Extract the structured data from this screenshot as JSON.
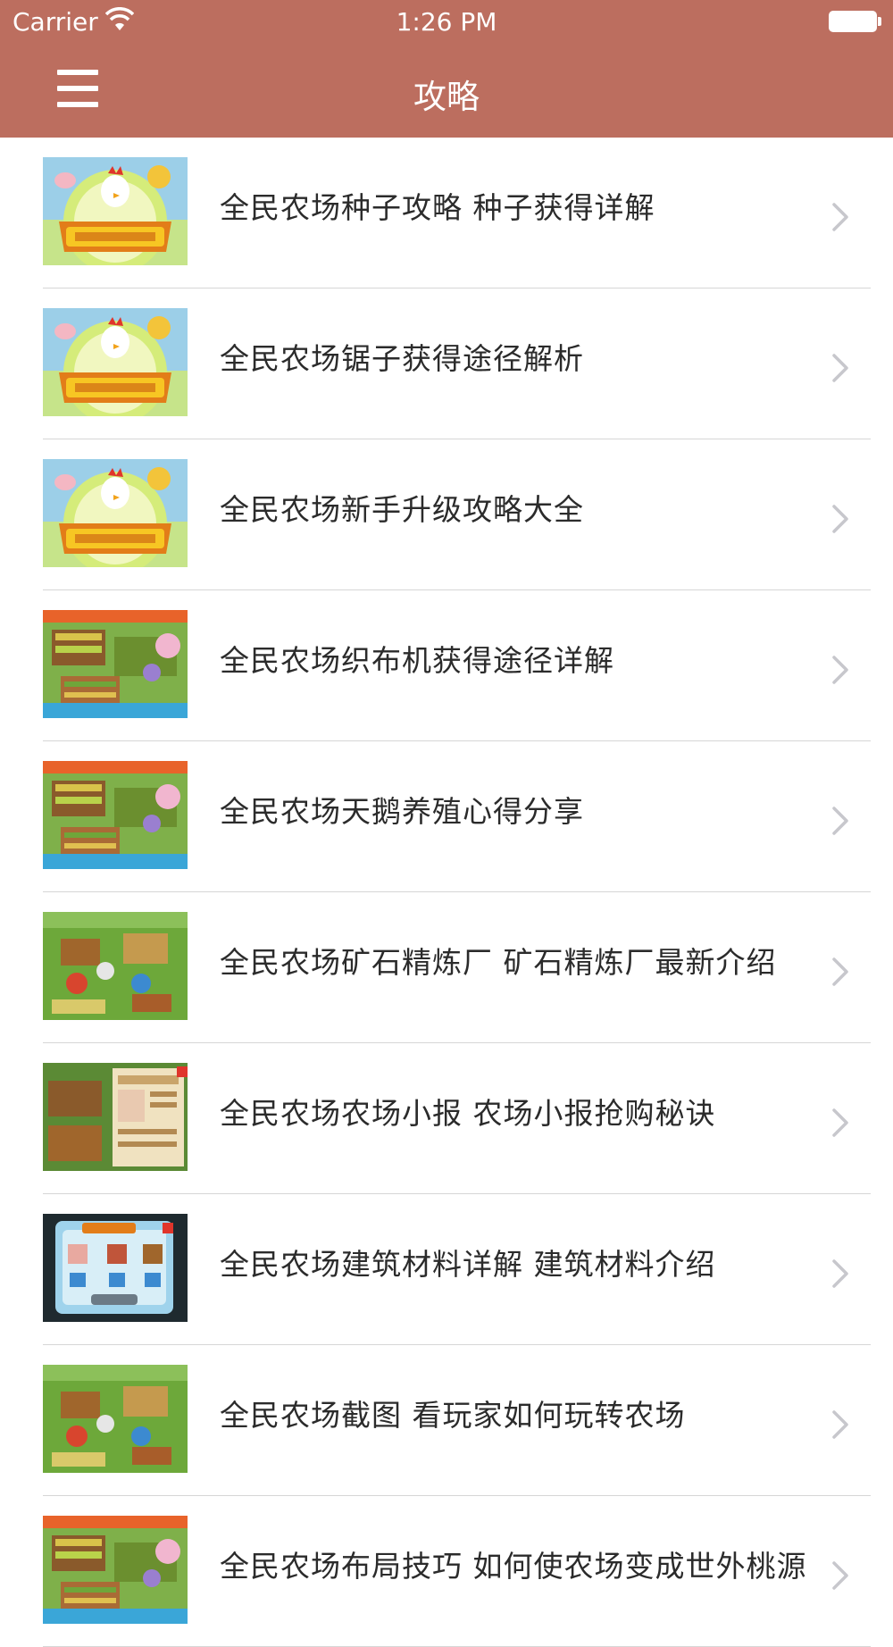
{
  "status_bar": {
    "carrier": "Carrier",
    "time": "1:26 PM"
  },
  "nav": {
    "title": "攻略",
    "menu_icon": "hamburger-menu-icon"
  },
  "colors": {
    "nav_background": "#bc6e5f",
    "separator": "#d6d6d6",
    "chevron": "#c7c7cc"
  },
  "articles": [
    {
      "title": "全民农场种子攻略 种子获得详解",
      "thumbnail": "game-logo"
    },
    {
      "title": "全民农场锯子获得途径解析",
      "thumbnail": "game-logo"
    },
    {
      "title": "全民农场新手升级攻略大全",
      "thumbnail": "game-logo"
    },
    {
      "title": "全民农场织布机获得途径详解",
      "thumbnail": "farm-fields"
    },
    {
      "title": "全民农场天鹅养殖心得分享",
      "thumbnail": "farm-fields"
    },
    {
      "title": "全民农场矿石精炼厂 矿石精炼厂最新介绍",
      "thumbnail": "farm-gameplay"
    },
    {
      "title": "全民农场农场小报 农场小报抢购秘诀",
      "thumbnail": "newspaper-panel"
    },
    {
      "title": "全民农场建筑材料详解 建筑材料介绍",
      "thumbnail": "materials-dialog"
    },
    {
      "title": "全民农场截图 看玩家如何玩转农场",
      "thumbnail": "farm-gameplay"
    },
    {
      "title": "全民农场布局技巧 如何使农场变成世外桃源",
      "thumbnail": "farm-fields"
    }
  ]
}
